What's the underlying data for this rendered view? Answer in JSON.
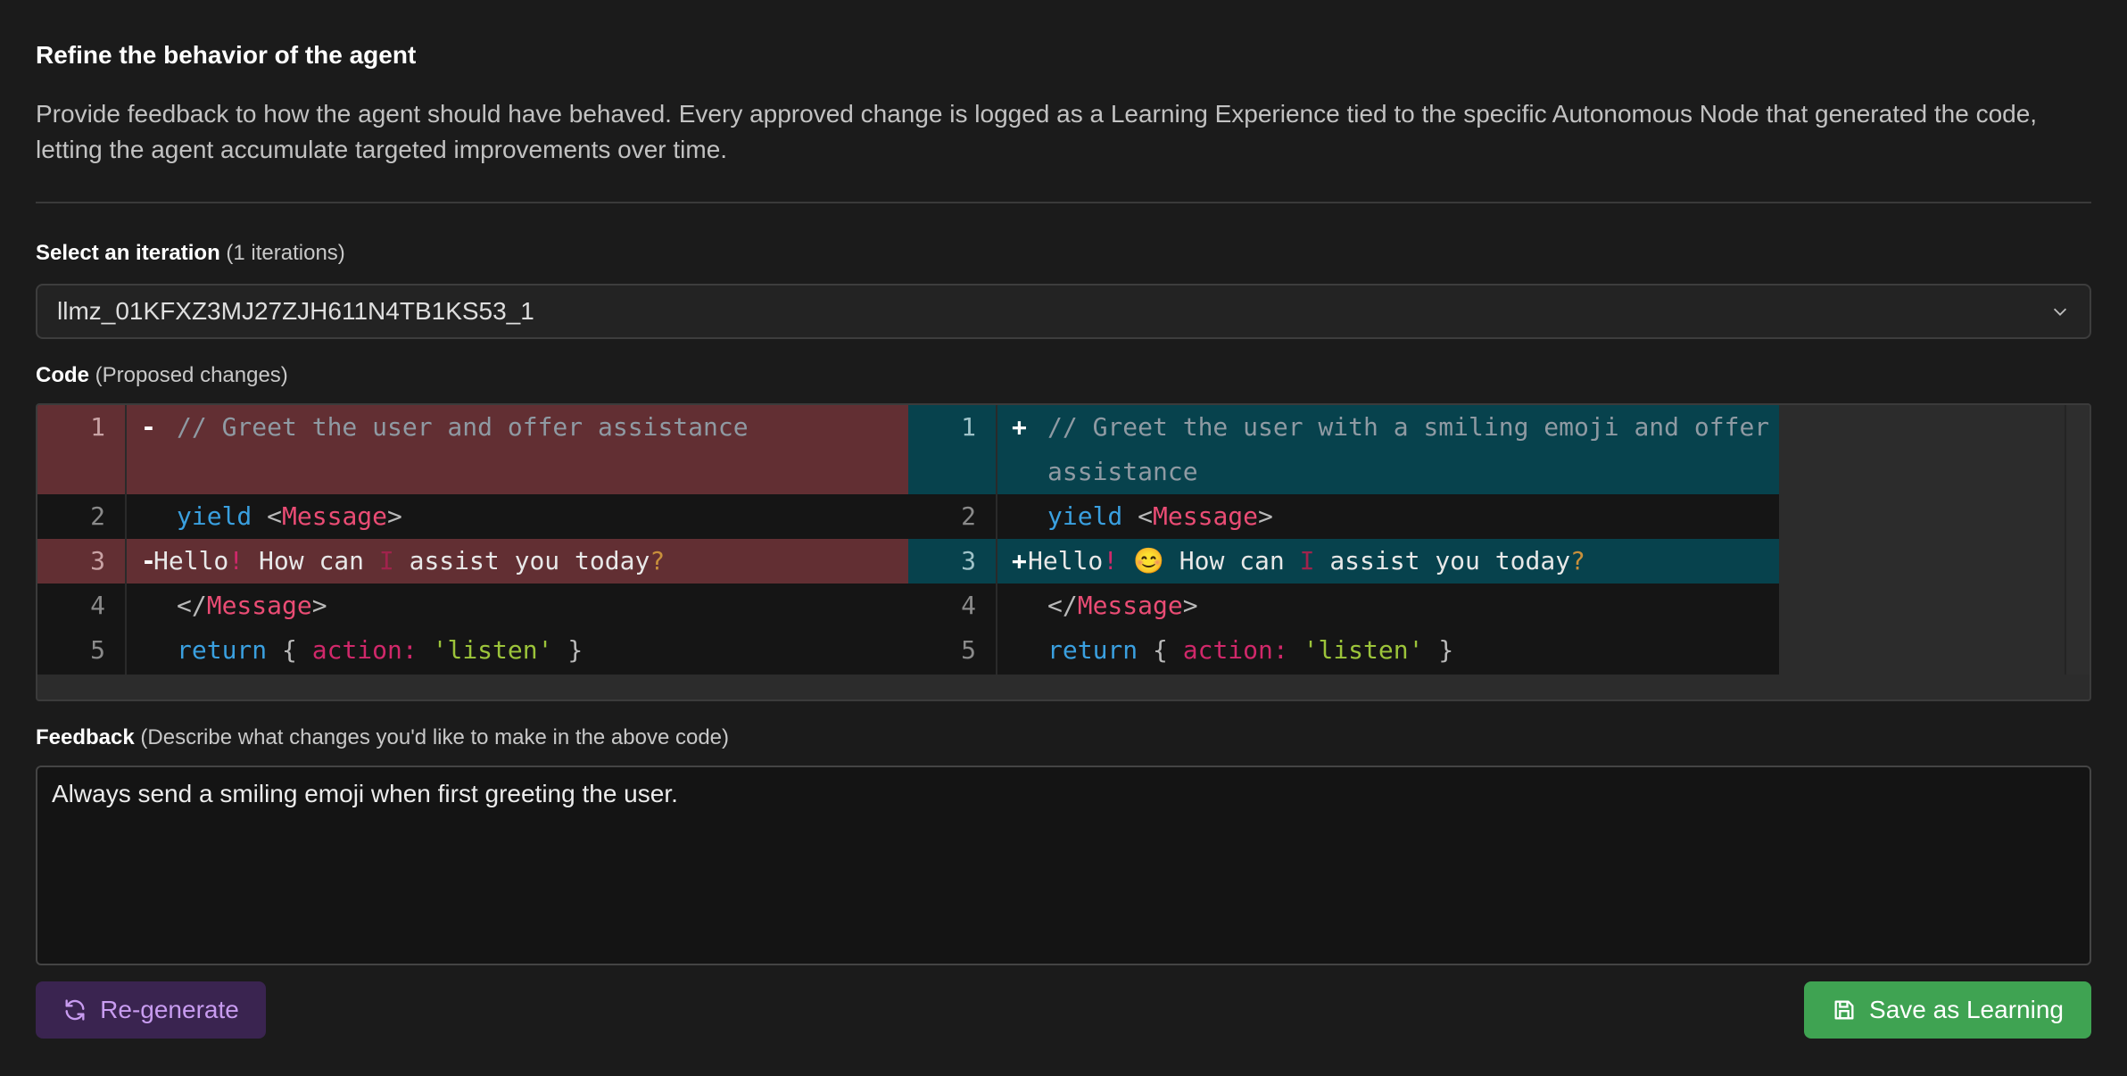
{
  "header": {
    "title": "Refine the behavior of the agent",
    "description": "Provide feedback to how the agent should have behaved. Every approved change is logged as a Learning Experience tied to the specific Autonomous Node that generated the code, letting the agent accumulate targeted improvements over time."
  },
  "iteration": {
    "label": "Select an iteration",
    "count_text": "(1 iterations)",
    "selected_value": "llmz_01KFXZ3MJ27ZJH611N4TB1KS53_1",
    "icon": "chevron-down-icon"
  },
  "code": {
    "label": "Code",
    "sub_label": "(Proposed changes)",
    "line_numbers": [
      "1",
      "2",
      "3",
      "4",
      "5"
    ],
    "del_sign": "-",
    "add_sign": "+",
    "left": {
      "line1": "// Greet the user and offer assistance",
      "line2_kw": "yield",
      "line2_tag": "Message",
      "line3_a": "Hello",
      "line3_excl": "!",
      "line3_b": " How can ",
      "line3_i": "I",
      "line3_c": " assist you today",
      "line3_q": "?",
      "line4_tag": "Message",
      "line5_kw": "return",
      "line5_attr": "action",
      "line5_str": "'listen'"
    },
    "right": {
      "line1": "// Greet the user with a smiling emoji and offer assistance",
      "line2_kw": "yield",
      "line2_tag": "Message",
      "line3_a": "Hello",
      "line3_excl": "!",
      "line3_emoji": "😊",
      "line3_b": " How can ",
      "line3_i": "I",
      "line3_c": " assist you today",
      "line3_q": "?",
      "line4_tag": "Message",
      "line5_kw": "return",
      "line5_attr": "action",
      "line5_str": "'listen'"
    }
  },
  "feedback": {
    "label": "Feedback",
    "sub_label": "(Describe what changes you'd like to make in the above code)",
    "value": "Always send a smiling emoji when first greeting the user."
  },
  "buttons": {
    "regenerate": "Re-generate",
    "save": "Save as Learning"
  },
  "colors": {
    "deleted_bg": "#622f33",
    "added_bg": "#07424d",
    "save_button": "#3fa352",
    "regenerate_button": "#3a2450"
  }
}
